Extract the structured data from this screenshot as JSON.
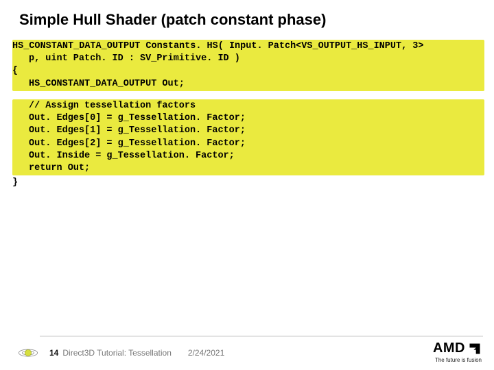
{
  "title": "Simple Hull Shader (patch constant phase)",
  "code": {
    "block1": {
      "l1": "HS_CONSTANT_DATA_OUTPUT Constants. HS( Input. Patch<VS_OUTPUT_HS_INPUT, 3>",
      "l2": " p, uint Patch. ID : SV_Primitive. ID )",
      "l3": "{",
      "l4": "HS_CONSTANT_DATA_OUTPUT Out;"
    },
    "block2": {
      "l1": "// Assign tessellation factors",
      "l2": "Out. Edges[0] = g_Tessellation. Factor;",
      "l3": "Out. Edges[1] = g_Tessellation. Factor;",
      "l4": "Out. Edges[2] = g_Tessellation. Factor;",
      "l5": "Out. Inside   = g_Tessellation. Factor;",
      "l6": "return Out;"
    },
    "close": "}"
  },
  "footer": {
    "page": "14",
    "label": "Direct3D Tutorial: Tessellation",
    "date": "2/24/2021"
  },
  "logo": {
    "brand": "AMD",
    "tagline": "The future is fusion"
  }
}
